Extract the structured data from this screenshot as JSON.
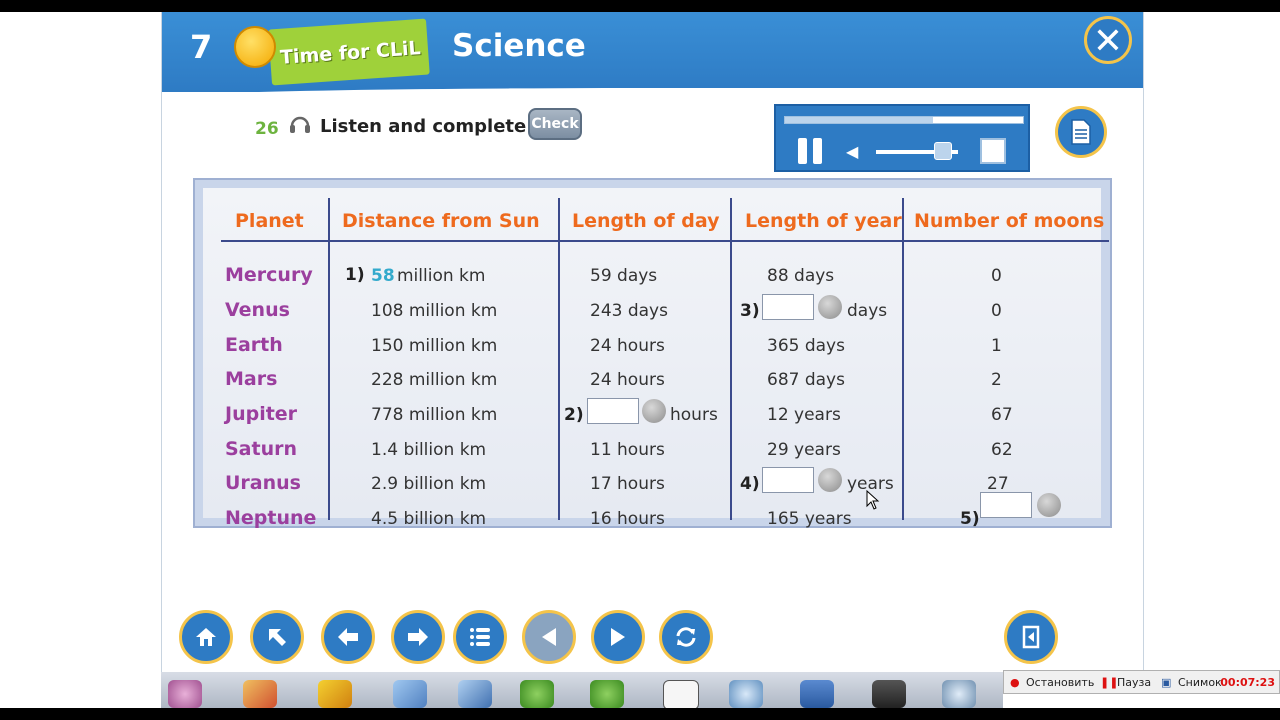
{
  "header": {
    "unit_number": "7",
    "badge": "Time for CLiL",
    "title": "Science",
    "close_label": "✕"
  },
  "exercise": {
    "track": "26",
    "instruction": "Listen and complete.",
    "check_label": "Check"
  },
  "player": {
    "progress": 0.62,
    "volume": 0.8
  },
  "table": {
    "headers": [
      "Planet",
      "Distance from Sun",
      "Length of day",
      "Length of year",
      "Number of moons"
    ],
    "rows": [
      {
        "planet": "Mercury",
        "distance_prefix": "1)",
        "distance_value": "58",
        "distance": "million km",
        "day": "59 days",
        "year": "88 days",
        "moons": "0"
      },
      {
        "planet": "Venus",
        "distance": "108 million km",
        "day": "243 days",
        "year_prefix": "3)",
        "year_unit": "days",
        "moons": "0"
      },
      {
        "planet": "Earth",
        "distance": "150 million km",
        "day": "24 hours",
        "year": "365 days",
        "moons": "1"
      },
      {
        "planet": "Mars",
        "distance": "228 million km",
        "day": "24 hours",
        "year": "687 days",
        "moons": "2"
      },
      {
        "planet": "Jupiter",
        "distance": "778 million km",
        "day_prefix": "2)",
        "day_unit": "hours",
        "year": "12 years",
        "moons": "67"
      },
      {
        "planet": "Saturn",
        "distance": "1.4 billion km",
        "day": "11 hours",
        "year": "29 years",
        "moons": "62"
      },
      {
        "planet": "Uranus",
        "distance": "2.9 billion km",
        "day": "17 hours",
        "year_prefix": "4)",
        "year_unit": "years",
        "moons": "27"
      },
      {
        "planet": "Neptune",
        "distance": "4.5 billion km",
        "day": "16 hours",
        "year": "165 years",
        "moons_prefix": "5)"
      }
    ]
  },
  "recorder": {
    "stop": "Остановить",
    "pause": "Пауза",
    "snapshot": "Снимок",
    "time": "00:07:23"
  },
  "colors": {
    "header_blue": "#2e7bc4",
    "planet_purple": "#9b3f9e",
    "heading_orange": "#ee6a1e",
    "button_ring": "#f4c44a"
  }
}
